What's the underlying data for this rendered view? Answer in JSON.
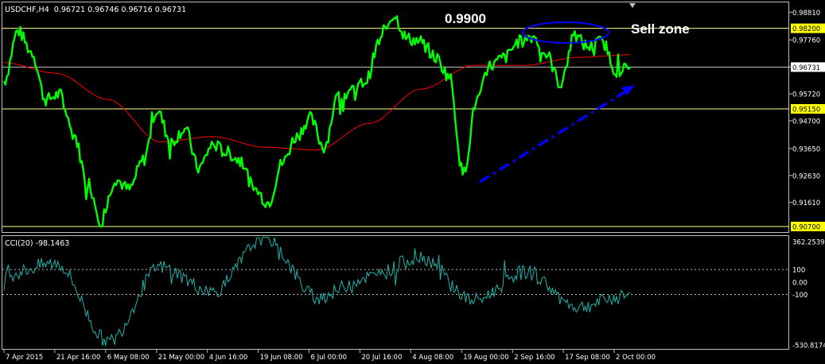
{
  "window": {
    "symbol_line": "USDCHF,H4  0.96721 0.96746 0.96716 0.96731",
    "indicator_label": "CCI(20) -98.1463"
  },
  "colors": {
    "background": "#000000",
    "price": "#00ff00",
    "moving_average": "#ff0000",
    "cci": "#20b2aa",
    "level_line": "#ffff80",
    "level_box": "#ffff00",
    "grid_frame": "#c0c0c0",
    "trend_arrow": "#0000ff",
    "annotation_text": "#ffffff"
  },
  "annotations": {
    "peak_label": "0.9900",
    "sell_zone_label": "Sell zone"
  },
  "chart_data": [
    {
      "type": "line",
      "title": "USDCHF,H4",
      "y_axis_ticks": [
        "0.98810",
        "0.97760",
        "0.96731",
        "0.95720",
        "0.94700",
        "0.93650",
        "0.92630",
        "0.91610"
      ],
      "level_labels": [
        "0.98200",
        "0.95150",
        "0.90700"
      ],
      "levels": [
        0.982,
        0.9515,
        0.907
      ],
      "current_price": 0.96731,
      "ylim": [
        0.9055,
        0.9915
      ],
      "x_tick_labels": [
        "7 Apr 2015",
        "21 Apr 16:00",
        "6 May 08:00",
        "21 May 00:00",
        "4 Jun 16:00",
        "19 Jun 08:00",
        "6 Jul 00:00",
        "20 Jul 16:00",
        "4 Aug 08:00",
        "19 Aug 00:00",
        "2 Sep 16:00",
        "17 Sep 08:00",
        "2 Oct 00:00"
      ],
      "series": [
        {
          "name": "USDCHF close",
          "x": [
            "7 Apr 2015",
            "12 Apr",
            "16 Apr",
            "21 Apr 16:00",
            "24 Apr",
            "29 Apr",
            "3 May",
            "6 May 08:00",
            "10 May",
            "14 May",
            "18 May",
            "21 May 00:00",
            "24 May",
            "28 May",
            "1 Jun",
            "4 Jun 16:00",
            "9 Jun",
            "13 Jun",
            "16 Jun",
            "19 Jun 08:00",
            "24 Jun",
            "29 Jun",
            "6 Jul 00:00",
            "10 Jul",
            "15 Jul",
            "20 Jul 16:00",
            "25 Jul",
            "30 Jul",
            "4 Aug 08:00",
            "7 Aug",
            "10 Aug",
            "14 Aug",
            "17 Aug",
            "19 Aug 00:00",
            "21 Aug",
            "25 Aug",
            "29 Aug",
            "2 Sep 16:00",
            "7 Sep",
            "12 Sep",
            "14 Sep",
            "17 Sep 08:00",
            "22 Sep",
            "26 Sep",
            "30 Sep",
            "2 Oct 00:00"
          ],
          "values": [
            0.962,
            0.981,
            0.973,
            0.955,
            0.957,
            0.942,
            0.924,
            0.909,
            0.925,
            0.921,
            0.932,
            0.951,
            0.939,
            0.944,
            0.929,
            0.938,
            0.935,
            0.932,
            0.921,
            0.916,
            0.931,
            0.941,
            0.948,
            0.937,
            0.956,
            0.958,
            0.962,
            0.977,
            0.987,
            0.978,
            0.977,
            0.971,
            0.964,
            0.927,
            0.955,
            0.968,
            0.971,
            0.977,
            0.979,
            0.972,
            0.961,
            0.979,
            0.975,
            0.977,
            0.966,
            0.967
          ]
        },
        {
          "name": "Moving average",
          "x": [
            "7 Apr 2015",
            "21 Apr 16:00",
            "6 May 08:00",
            "21 May 00:00",
            "4 Jun 16:00",
            "19 Jun 08:00",
            "6 Jul 00:00",
            "20 Jul 16:00",
            "4 Aug 08:00",
            "19 Aug 00:00",
            "2 Sep 16:00",
            "17 Sep 08:00",
            "2 Oct 00:00"
          ],
          "values": [
            0.969,
            0.965,
            0.955,
            0.939,
            0.941,
            0.937,
            0.936,
            0.946,
            0.959,
            0.968,
            0.968,
            0.971,
            0.972
          ]
        }
      ]
    },
    {
      "type": "line",
      "title": "CCI(20)",
      "y_axis_ticks": [
        "362.2539",
        "100",
        "0.00",
        "-100",
        "-530.8174"
      ],
      "levels": [
        100,
        -100
      ],
      "ylim": [
        -530.8174,
        362.2539
      ],
      "series": [
        {
          "name": "CCI(20)",
          "x": [
            "7 Apr 2015",
            "21 Apr 16:00",
            "6 May 08:00",
            "21 May 00:00",
            "4 Jun 16:00",
            "19 Jun 08:00",
            "6 Jul 00:00",
            "20 Jul 16:00",
            "4 Aug 08:00",
            "19 Aug 00:00",
            "2 Sep 16:00",
            "17 Sep 08:00",
            "2 Oct 00:00"
          ],
          "values": [
            60,
            150,
            -480,
            120,
            -80,
            360,
            -120,
            40,
            200,
            -150,
            80,
            -200,
            -98.1463
          ]
        }
      ]
    }
  ]
}
